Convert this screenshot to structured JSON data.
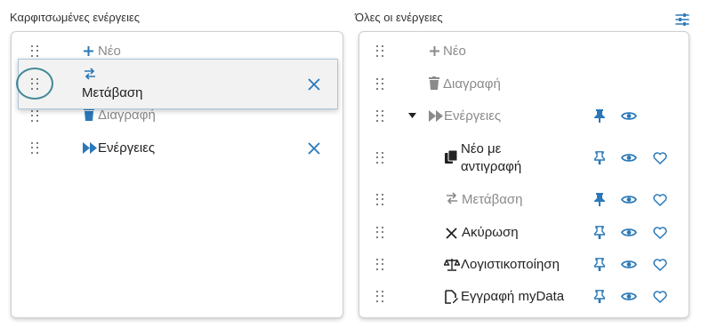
{
  "pinned": {
    "title": "Καρφιτσωμένες ενέργειες",
    "new_label": "Νέο",
    "dragging_label": "Μετάβαση",
    "delete_label": "Διαγραφή",
    "actions_label": "Ενέργειες"
  },
  "all": {
    "title": "Όλες οι ενέργειες",
    "rows": [
      {
        "label": "Νέο",
        "muted": true
      },
      {
        "label": "Διαγραφή",
        "muted": true
      },
      {
        "label": "Ενέργειες",
        "muted": true,
        "pinned": true,
        "visible": true
      },
      {
        "label_line1": "Νέο με",
        "label_line2": "αντιγραφή",
        "pinned": false,
        "visible": true,
        "favorite": false
      },
      {
        "label": "Μετάβαση",
        "muted": true,
        "pinned": true,
        "visible": true,
        "favorite": false
      },
      {
        "label": "Ακύρωση",
        "pinned": false,
        "visible": true,
        "favorite": false
      },
      {
        "label": "Λογιστικοποίηση",
        "pinned": false,
        "visible": true,
        "favorite": false
      },
      {
        "label": "Εγγραφή myData",
        "pinned": false,
        "visible": true,
        "favorite": false
      }
    ]
  },
  "colors": {
    "accent": "#2a78b8",
    "highlight_ring": "#3f8a96",
    "muted_text": "#8a8a8a"
  }
}
